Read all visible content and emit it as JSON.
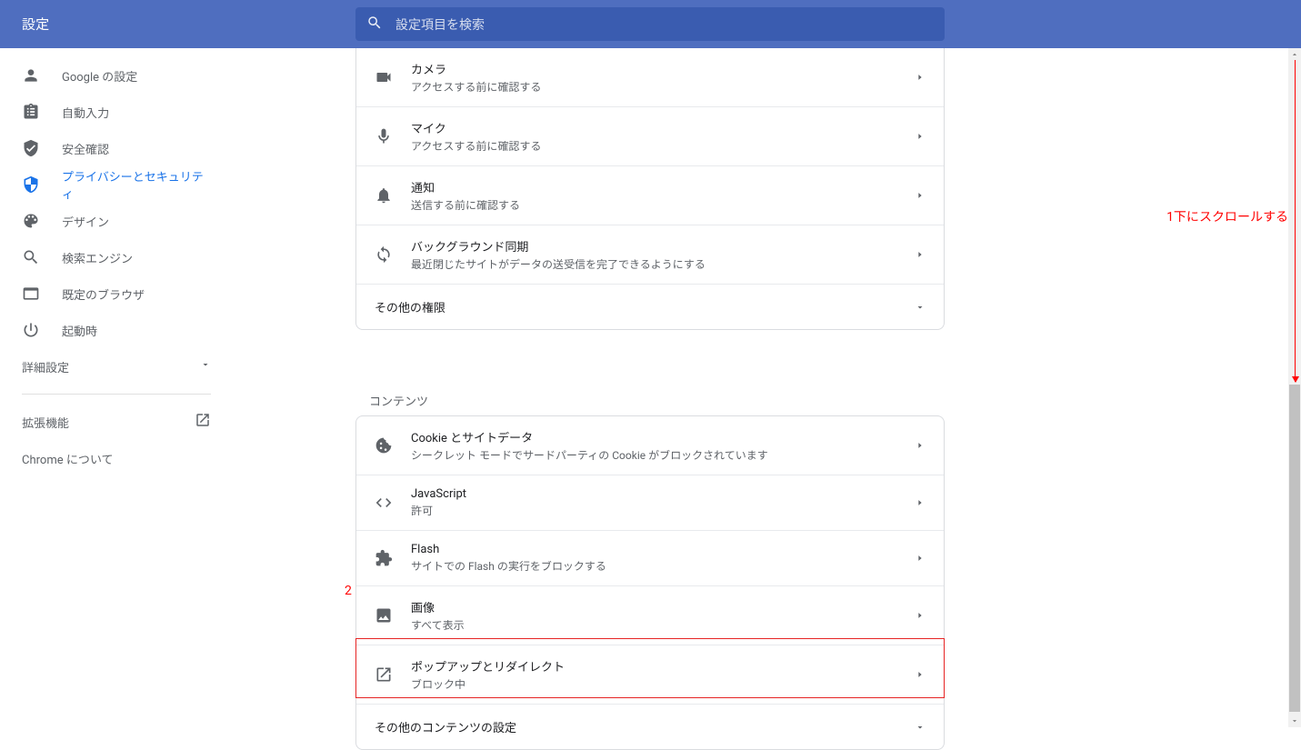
{
  "header": {
    "title": "設定",
    "search_placeholder": "設定項目を検索"
  },
  "sidebar": {
    "items": [
      {
        "label": "Google の設定"
      },
      {
        "label": "自動入力"
      },
      {
        "label": "安全確認"
      },
      {
        "label": "プライバシーとセキュリティ"
      },
      {
        "label": "デザイン"
      },
      {
        "label": "検索エンジン"
      },
      {
        "label": "既定のブラウザ"
      },
      {
        "label": "起動時"
      }
    ],
    "advanced": "詳細設定",
    "extensions": "拡張機能",
    "about": "Chrome について"
  },
  "permissions": {
    "camera": {
      "title": "カメラ",
      "sub": "アクセスする前に確認する"
    },
    "mic": {
      "title": "マイク",
      "sub": "アクセスする前に確認する"
    },
    "notification": {
      "title": "通知",
      "sub": "送信する前に確認する"
    },
    "bgsync": {
      "title": "バックグラウンド同期",
      "sub": "最近閉じたサイトがデータの送受信を完了できるようにする"
    },
    "other": "その他の権限"
  },
  "content_section": {
    "label": "コンテンツ",
    "cookie": {
      "title": "Cookie とサイトデータ",
      "sub": "シークレット モードでサードパーティの Cookie がブロックされています"
    },
    "js": {
      "title": "JavaScript",
      "sub": "許可"
    },
    "flash": {
      "title": "Flash",
      "sub": "サイトでの Flash の実行をブロックする"
    },
    "image": {
      "title": "画像",
      "sub": "すべて表示"
    },
    "popup": {
      "title": "ポップアップとリダイレクト",
      "sub": "ブロック中"
    },
    "other": "その他のコンテンツの設定"
  },
  "annotations": {
    "scroll": "1下にスクロールする",
    "marker2": "2"
  }
}
